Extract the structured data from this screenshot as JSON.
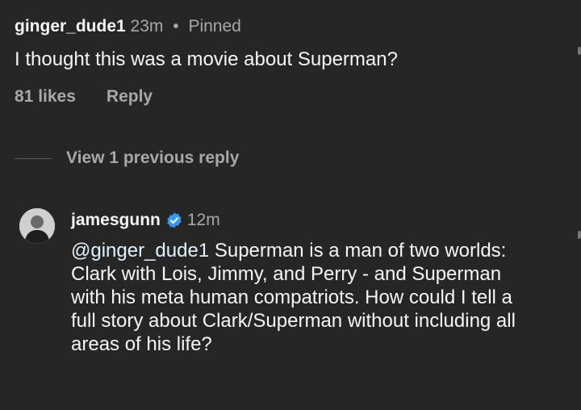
{
  "top_comment": {
    "username": "ginger_dude1",
    "time": "23m",
    "pinned_label": "Pinned",
    "separator": "•",
    "text": "I thought this was a movie about Superman?",
    "likes": "81 likes",
    "reply_label": "Reply"
  },
  "view_replies_label": "View 1 previous reply",
  "reply": {
    "username": "jamesgunn",
    "verified_icon": "verified-badge-icon",
    "verified_color": "#3897f0",
    "time": "12m",
    "mention": "@ginger_dude1",
    "text": " Superman is a man of two worlds: Clark with Lois, Jimmy, and Perry - and Superman with his meta human compatriots. How could I tell a full story about Clark/Superman without including all areas of his life?"
  },
  "colors": {
    "background": "#262626",
    "primary_text": "#f5f5f5",
    "secondary_text": "#a8a8a8"
  }
}
